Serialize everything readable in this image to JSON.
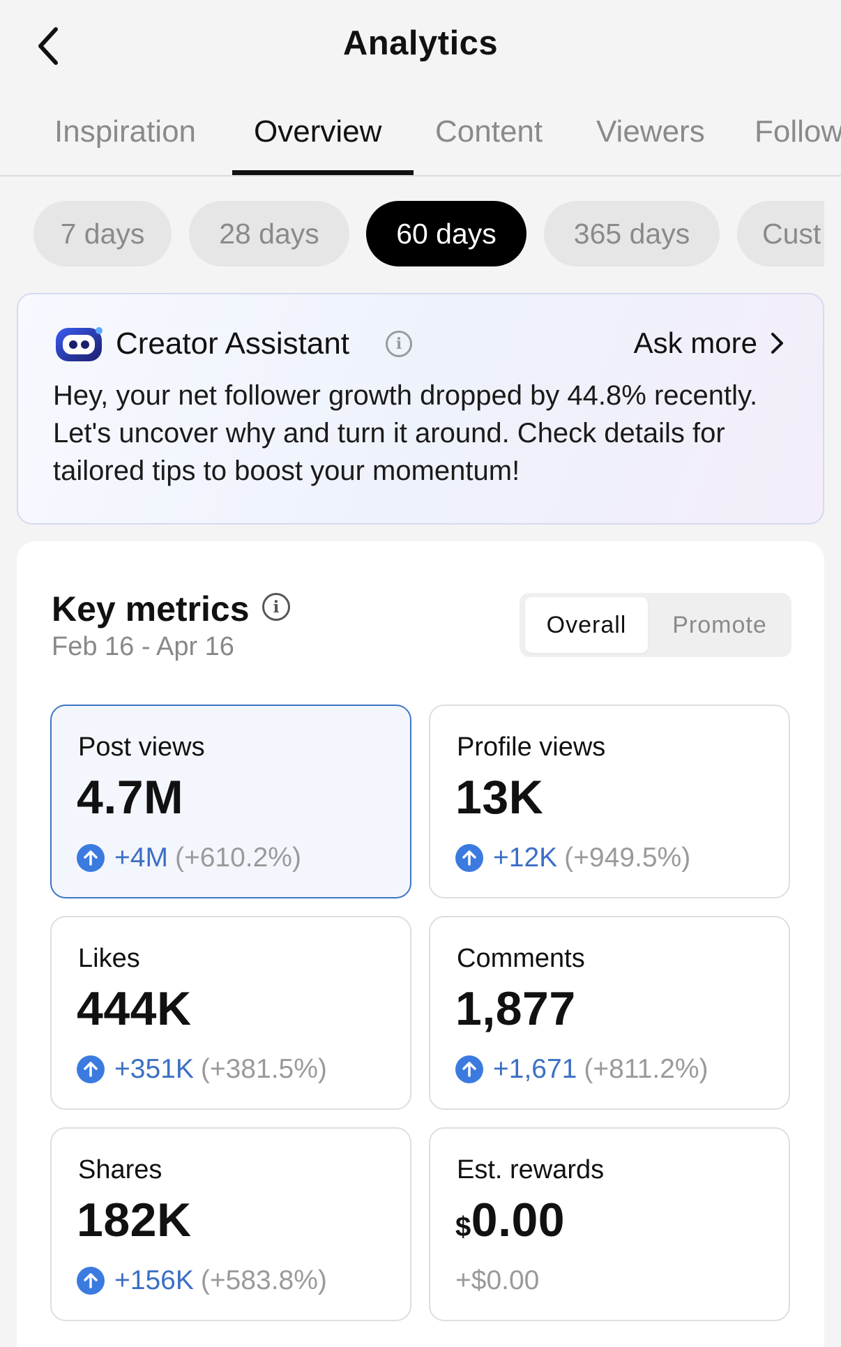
{
  "header": {
    "title": "Analytics",
    "back_icon": "chevron-left-icon"
  },
  "tabs": [
    {
      "label": "Inspiration",
      "active": false
    },
    {
      "label": "Overview",
      "active": true
    },
    {
      "label": "Content",
      "active": false
    },
    {
      "label": "Viewers",
      "active": false
    },
    {
      "label": "Follow",
      "active": false
    }
  ],
  "ranges": [
    {
      "label": "7 days",
      "active": false
    },
    {
      "label": "28 days",
      "active": false
    },
    {
      "label": "60 days",
      "active": true
    },
    {
      "label": "365 days",
      "active": false
    },
    {
      "label": "Cust",
      "active": false
    }
  ],
  "assistant": {
    "title": "Creator Assistant",
    "ask_more": "Ask more",
    "message": "Hey, your net follower growth dropped by 44.8% recently. Let's uncover why and turn it around. Check details for tailored tips to boost your momentum!"
  },
  "key_metrics": {
    "title": "Key metrics",
    "date_range": "Feb 16 - Apr 16",
    "toggle": {
      "overall": "Overall",
      "promote": "Promote",
      "selected": "Overall"
    },
    "tiles": [
      {
        "label": "Post views",
        "value": "4.7M",
        "delta": "+4M",
        "delta_pct": "(+610.2%)",
        "selected": true
      },
      {
        "label": "Profile views",
        "value": "13K",
        "delta": "+12K",
        "delta_pct": "(+949.5%)",
        "selected": false
      },
      {
        "label": "Likes",
        "value": "444K",
        "delta": "+351K",
        "delta_pct": "(+381.5%)",
        "selected": false
      },
      {
        "label": "Comments",
        "value": "1,877",
        "delta": "+1,671",
        "delta_pct": "(+811.2%)",
        "selected": false
      },
      {
        "label": "Shares",
        "value": "182K",
        "delta": "+156K",
        "delta_pct": "(+583.8%)",
        "selected": false
      },
      {
        "label": "Est. rewards",
        "currency": "$",
        "value": "0.00",
        "delta": "+$0.00",
        "selected": false
      }
    ]
  },
  "colors": {
    "accent_blue": "#3b7be0",
    "selected_border": "#3e74c4",
    "delta_text": "#3b6fc4"
  }
}
